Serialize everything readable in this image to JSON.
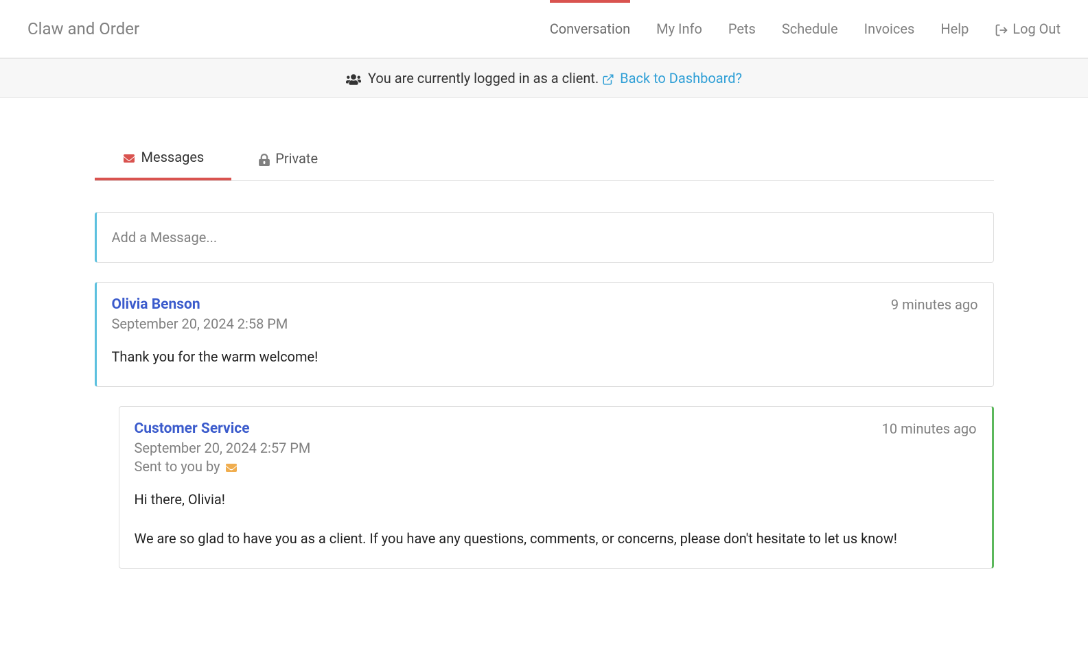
{
  "brand": "Claw and Order",
  "nav": {
    "conversation": "Conversation",
    "my_info": "My Info",
    "pets": "Pets",
    "schedule": "Schedule",
    "invoices": "Invoices",
    "help": "Help",
    "logout": "Log Out"
  },
  "notice": {
    "text": "You are currently logged in as a client. ",
    "link": "Back to Dashboard?"
  },
  "tabs": {
    "messages": "Messages",
    "private": "Private"
  },
  "compose": {
    "placeholder": "Add a Message..."
  },
  "messages": [
    {
      "author": "Olivia Benson",
      "date": "September 20, 2024 2:58 PM",
      "ago": "9 minutes ago",
      "body_p1": "Thank you for the warm welcome!"
    },
    {
      "author": "Customer Service",
      "date": "September 20, 2024 2:57 PM",
      "ago": "10 minutes ago",
      "sent_by_label": "Sent to you by",
      "body_p1": "Hi there, Olivia!",
      "body_p2": "We are so glad to have you as a client. If you have any questions, comments, or concerns, please don't hesitate to let us know!"
    }
  ]
}
